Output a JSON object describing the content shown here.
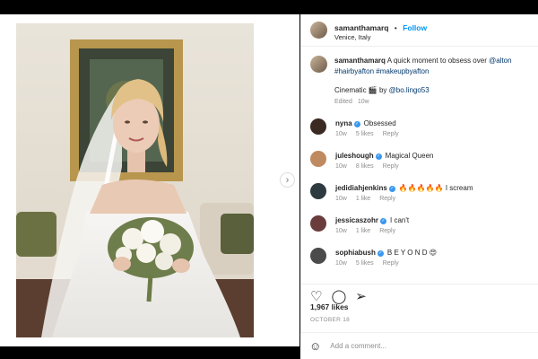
{
  "header": {
    "username": "samanthamarq",
    "separator": "•",
    "follow_label": "Follow",
    "location": "Venice, Italy"
  },
  "caption": {
    "username": "samanthamarq",
    "text": "A quick moment to obsess over",
    "mention": "@alton",
    "tags": "#hairbyafton #makeupbyafton",
    "credit_prefix": "Cinematic 🎬 by",
    "credit_mention": "@bo.lingo53",
    "edited": "Edited",
    "time": "10w"
  },
  "comments": [
    {
      "user": "nyna",
      "text": "Obsessed",
      "time": "10w",
      "likes": "5 likes",
      "reply": "Reply",
      "avatar_color": "#3b2a22"
    },
    {
      "user": "juleshough",
      "text": "Magical Queen",
      "time": "10w",
      "likes": "8 likes",
      "reply": "Reply",
      "avatar_color": "#c08a60"
    },
    {
      "user": "jedidiahjenkins",
      "text": "🔥🔥🔥🔥🔥 I scream",
      "time": "10w",
      "likes": "1 like",
      "reply": "Reply",
      "avatar_color": "#2d3a3f"
    },
    {
      "user": "jessicaszohr",
      "text": "I can't",
      "time": "10w",
      "likes": "1 like",
      "reply": "Reply",
      "avatar_color": "#6b3c3c"
    },
    {
      "user": "sophiabush",
      "text": "B E Y O N D 😍",
      "time": "10w",
      "likes": "5 likes",
      "reply": "Reply",
      "avatar_color": "#4b4b4b"
    }
  ],
  "actions": {
    "like_icon": "heart-icon",
    "comment_icon": "comment-icon",
    "share_icon": "share-icon"
  },
  "likes_count": "1,967 likes",
  "date": "OCTOBER 18",
  "add_comment": {
    "placeholder": "Add a comment...",
    "emoji_icon": "emoji-icon"
  },
  "colors": {
    "accent": "#0095f6",
    "verified": "#3897f0",
    "muted": "#8e8e8e"
  }
}
